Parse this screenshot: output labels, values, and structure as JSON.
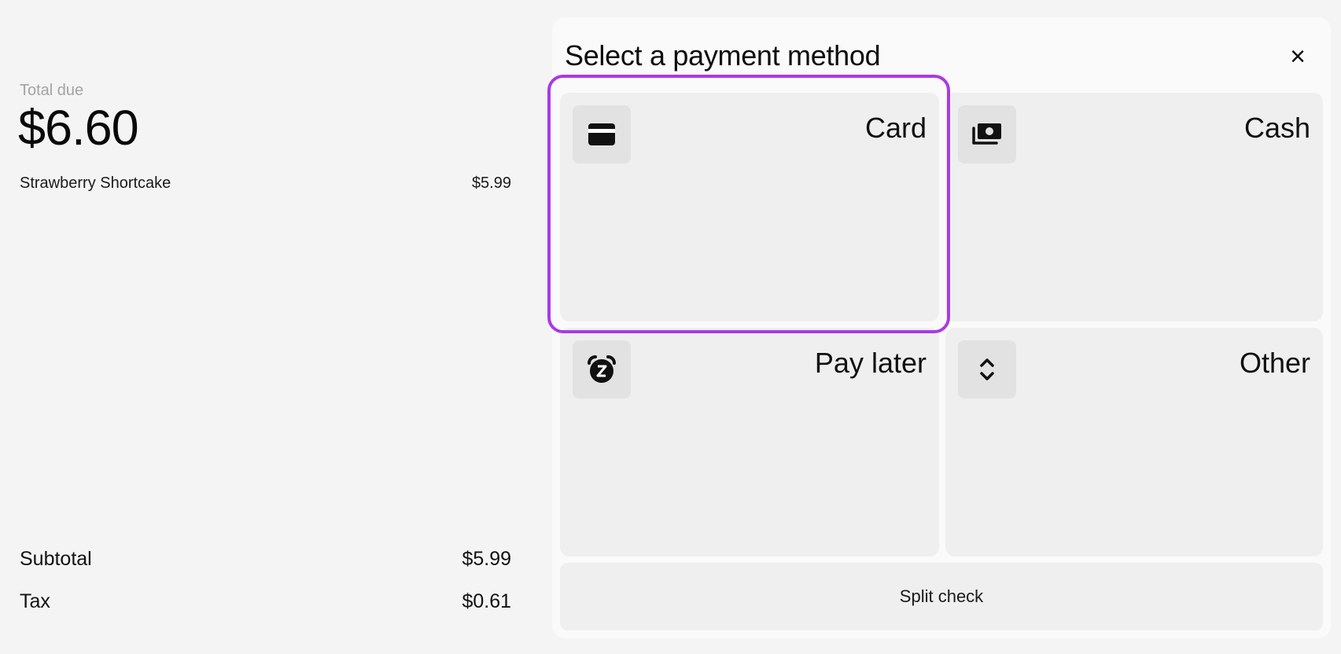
{
  "summary": {
    "total_label": "Total due",
    "total_amount": "$6.60",
    "items": [
      {
        "name": "Strawberry Shortcake",
        "price": "$5.99"
      }
    ],
    "subtotal_label": "Subtotal",
    "subtotal_value": "$5.99",
    "tax_label": "Tax",
    "tax_value": "$0.61"
  },
  "modal": {
    "title": "Select a payment method",
    "close_glyph": "×",
    "methods": [
      {
        "label": "Card",
        "icon": "credit-card-icon",
        "selected": true
      },
      {
        "label": "Cash",
        "icon": "cash-icon"
      },
      {
        "label": "Pay later",
        "icon": "alarm-clock-icon"
      },
      {
        "label": "Other",
        "icon": "chevron-up-down-icon"
      }
    ],
    "split_label": "Split check"
  },
  "colors": {
    "highlight": "#a93ae4",
    "tile_bg": "#efefef",
    "icon_bg": "#e2e2e2"
  }
}
